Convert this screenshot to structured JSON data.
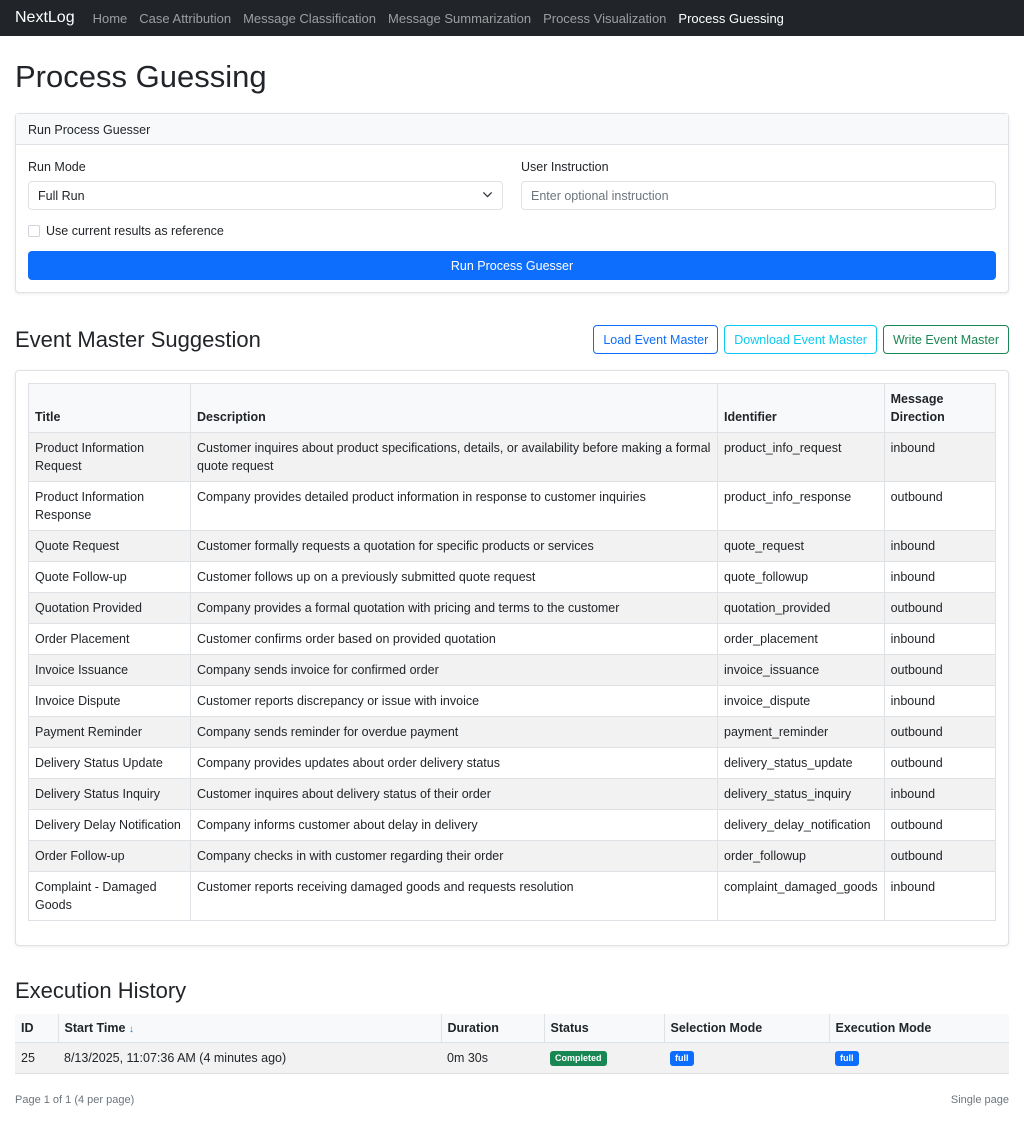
{
  "nav": {
    "brand": "NextLog",
    "links": [
      "Home",
      "Case Attribution",
      "Message Classification",
      "Message Summarization",
      "Process Visualization",
      "Process Guessing"
    ]
  },
  "page_title": "Process Guessing",
  "runner": {
    "header": "Run Process Guesser",
    "run_mode_label": "Run Mode",
    "run_mode_value": "Full Run",
    "instruction_label": "User Instruction",
    "instruction_placeholder": "Enter optional instruction",
    "reference_label": "Use current results as reference",
    "run_button": "Run Process Guesser"
  },
  "event_master": {
    "title": "Event Master Suggestion",
    "load_button": "Load Event Master",
    "download_button": "Download Event Master",
    "write_button": "Write Event Master",
    "columns": [
      "Title",
      "Description",
      "Identifier",
      "Message Direction"
    ],
    "rows": [
      {
        "title": "Product Information Request",
        "description": "Customer inquires about product specifications, details, or availability before making a formal quote request",
        "identifier": "product_info_request",
        "direction": "inbound"
      },
      {
        "title": "Product Information Response",
        "description": "Company provides detailed product information in response to customer inquiries",
        "identifier": "product_info_response",
        "direction": "outbound"
      },
      {
        "title": "Quote Request",
        "description": "Customer formally requests a quotation for specific products or services",
        "identifier": "quote_request",
        "direction": "inbound"
      },
      {
        "title": "Quote Follow-up",
        "description": "Customer follows up on a previously submitted quote request",
        "identifier": "quote_followup",
        "direction": "inbound"
      },
      {
        "title": "Quotation Provided",
        "description": "Company provides a formal quotation with pricing and terms to the customer",
        "identifier": "quotation_provided",
        "direction": "outbound"
      },
      {
        "title": "Order Placement",
        "description": "Customer confirms order based on provided quotation",
        "identifier": "order_placement",
        "direction": "inbound"
      },
      {
        "title": "Invoice Issuance",
        "description": "Company sends invoice for confirmed order",
        "identifier": "invoice_issuance",
        "direction": "outbound"
      },
      {
        "title": "Invoice Dispute",
        "description": "Customer reports discrepancy or issue with invoice",
        "identifier": "invoice_dispute",
        "direction": "inbound"
      },
      {
        "title": "Payment Reminder",
        "description": "Company sends reminder for overdue payment",
        "identifier": "payment_reminder",
        "direction": "outbound"
      },
      {
        "title": "Delivery Status Update",
        "description": "Company provides updates about order delivery status",
        "identifier": "delivery_status_update",
        "direction": "outbound"
      },
      {
        "title": "Delivery Status Inquiry",
        "description": "Customer inquires about delivery status of their order",
        "identifier": "delivery_status_inquiry",
        "direction": "inbound"
      },
      {
        "title": "Delivery Delay Notification",
        "description": "Company informs customer about delay in delivery",
        "identifier": "delivery_delay_notification",
        "direction": "outbound"
      },
      {
        "title": "Order Follow-up",
        "description": "Company checks in with customer regarding their order",
        "identifier": "order_followup",
        "direction": "outbound"
      },
      {
        "title": "Complaint - Damaged Goods",
        "description": "Customer reports receiving damaged goods and requests resolution",
        "identifier": "complaint_damaged_goods",
        "direction": "inbound"
      }
    ]
  },
  "history": {
    "title": "Execution History",
    "columns": [
      "ID",
      "Start Time",
      "Duration",
      "Status",
      "Selection Mode",
      "Execution Mode"
    ],
    "sort_indicator": "↓",
    "rows": [
      {
        "id": "25",
        "start": "8/13/2025, 11:07:36 AM (4 minutes ago)",
        "duration": "0m 30s",
        "status": "Completed",
        "selection": "full",
        "execution": "full"
      }
    ],
    "pagination": "Page 1 of 1 (4 per page)",
    "page_mode": "Single page"
  },
  "colors": {
    "primary": "#0d6efd",
    "success": "#198754",
    "info": "#0dcaf0",
    "navbar": "#212529"
  }
}
